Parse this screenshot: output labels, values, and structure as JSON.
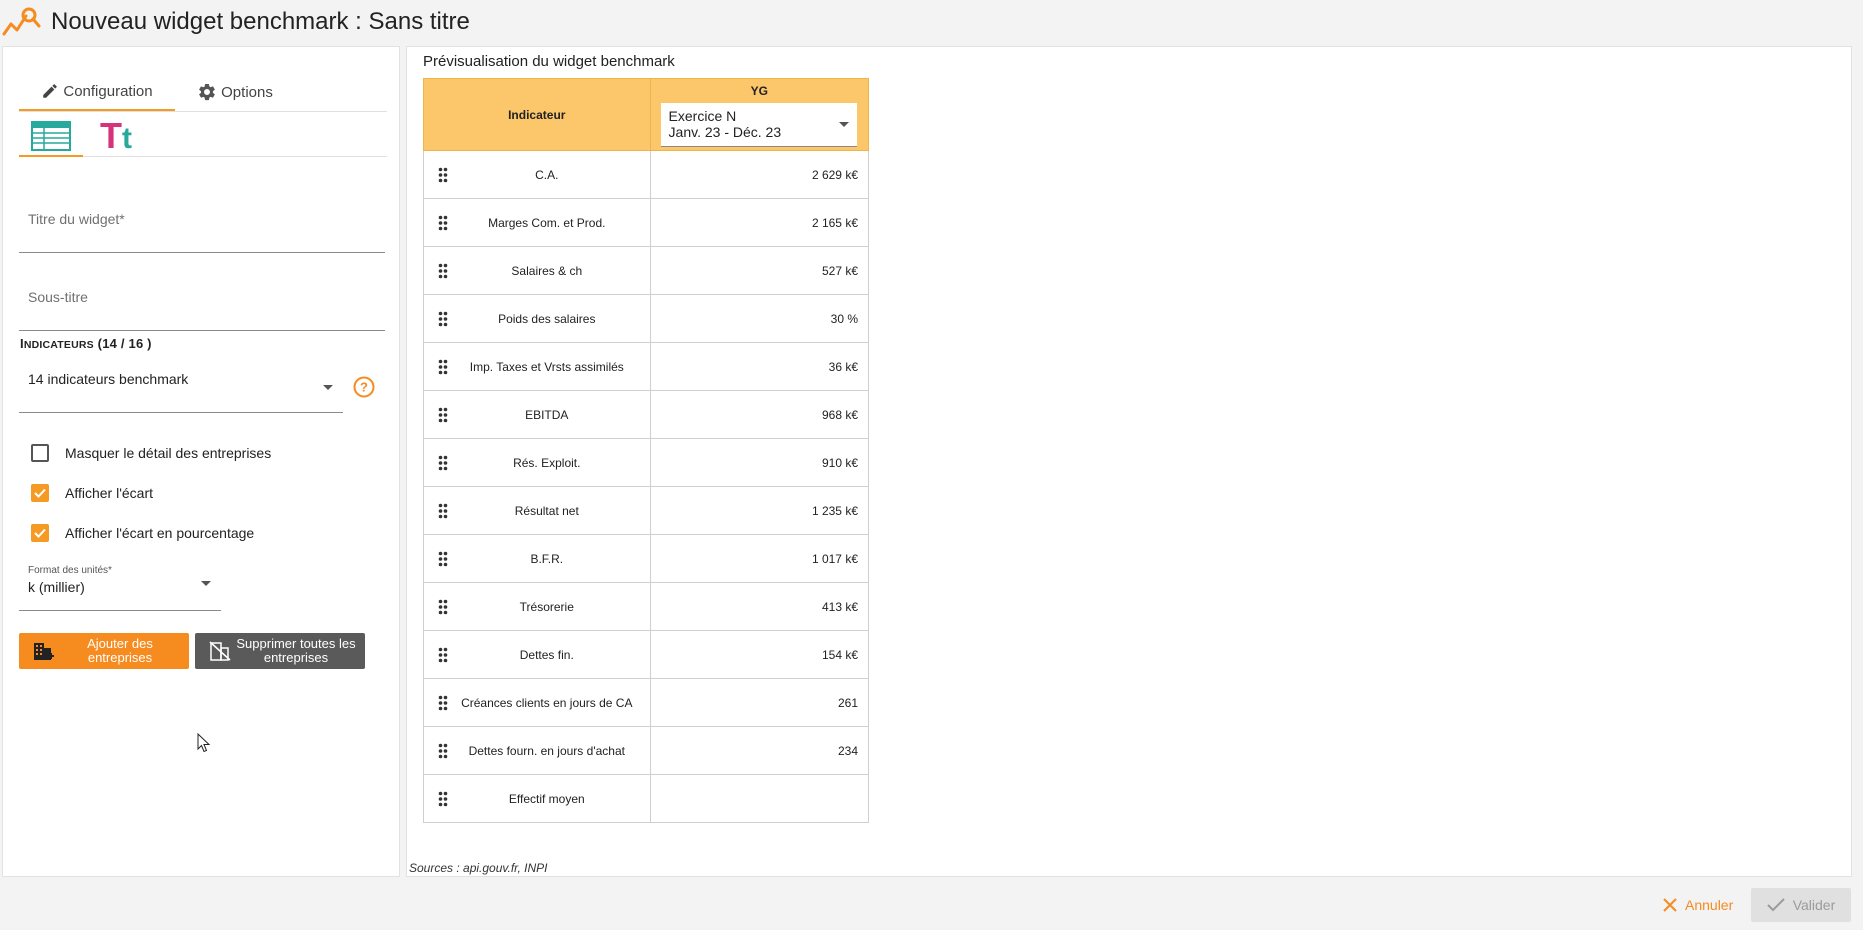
{
  "header": {
    "title": "Nouveau widget benchmark : Sans titre",
    "logo_icon": "chart-search-icon"
  },
  "config": {
    "tabs": [
      {
        "label": "Configuration",
        "icon": "pencil-icon"
      },
      {
        "label": "Options",
        "icon": "gear-icon"
      }
    ],
    "subtabs": [
      {
        "icon": "table-icon"
      },
      {
        "label": "Tt",
        "icon": "text-format-icon"
      }
    ],
    "widget_title_placeholder": "Titre du widget*",
    "subtitle_placeholder": "Sous-titre",
    "indicators_label": {
      "first": "I",
      "rest": "NDICATEURS",
      "count": " (14 /  16 )"
    },
    "indicators_value": "14 indicateurs benchmark",
    "checkboxes": [
      {
        "label": "Masquer le détail des entreprises",
        "checked": false
      },
      {
        "label": "Afficher l'écart",
        "checked": true
      },
      {
        "label": "Afficher l'écart en pourcentage",
        "checked": true
      }
    ],
    "units": {
      "label": "Format des unités*",
      "value": "k (millier)"
    },
    "add_button": "Ajouter des entreprises",
    "delete_button": "Supprimer toutes les entreprises",
    "accent_color": "#f68b1f"
  },
  "preview": {
    "title": "Prévisualisation du widget benchmark",
    "col_indicator": "Indicateur",
    "col_company": "YG",
    "period_line1": "Exercice N",
    "period_line2": "Janv. 23 - Déc. 23",
    "rows": [
      {
        "name": "C.A.",
        "value": "2 629 k€"
      },
      {
        "name": "Marges Com. et Prod.",
        "value": "2 165 k€"
      },
      {
        "name": "Salaires & ch",
        "value": "527 k€"
      },
      {
        "name": "Poids des salaires",
        "value": "30 %"
      },
      {
        "name": "Imp. Taxes et Vrsts assimilés",
        "value": "36 k€"
      },
      {
        "name": "EBITDA",
        "value": "968 k€"
      },
      {
        "name": "Rés. Exploit.",
        "value": "910 k€"
      },
      {
        "name": "Résultat net",
        "value": "1 235 k€"
      },
      {
        "name": "B.F.R.",
        "value": "1 017 k€"
      },
      {
        "name": "Trésorerie",
        "value": "413 k€"
      },
      {
        "name": "Dettes fin.",
        "value": "154 k€"
      },
      {
        "name": "Créances clients en jours de CA",
        "value": "261"
      },
      {
        "name": "Dettes fourn. en jours d'achat",
        "value": "234"
      },
      {
        "name": "Effectif moyen",
        "value": ""
      }
    ],
    "sources": "Sources : api.gouv.fr, INPI"
  },
  "footer": {
    "cancel": "Annuler",
    "validate": "Valider"
  }
}
